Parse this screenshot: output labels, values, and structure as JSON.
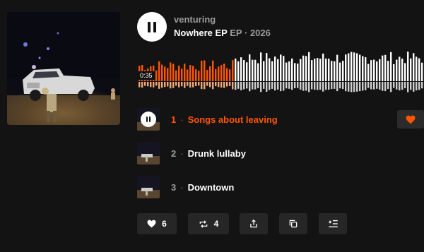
{
  "header": {
    "artist": "venturing",
    "title": "Nowhere EP",
    "kind": "EP",
    "separator": "·",
    "year": "2026"
  },
  "player": {
    "current_time": "0:35",
    "progress": 0.34,
    "state": "playing"
  },
  "tracks": [
    {
      "number": "1",
      "dot": "·",
      "title": "Songs about leaving",
      "active": true
    },
    {
      "number": "2",
      "dot": "·",
      "title": "Drunk lullaby",
      "active": false
    },
    {
      "number": "3",
      "dot": "·",
      "title": "Downtown",
      "active": false
    }
  ],
  "actions": {
    "likes": "6",
    "reposts": "4"
  },
  "colors": {
    "accent": "#ff5500",
    "background": "#131313",
    "button": "#262626",
    "muted_text": "#9a9a9a"
  },
  "icons": [
    "pause-icon",
    "heart-icon",
    "repost-icon",
    "share-icon",
    "copy-link-icon",
    "add-to-queue-icon"
  ]
}
